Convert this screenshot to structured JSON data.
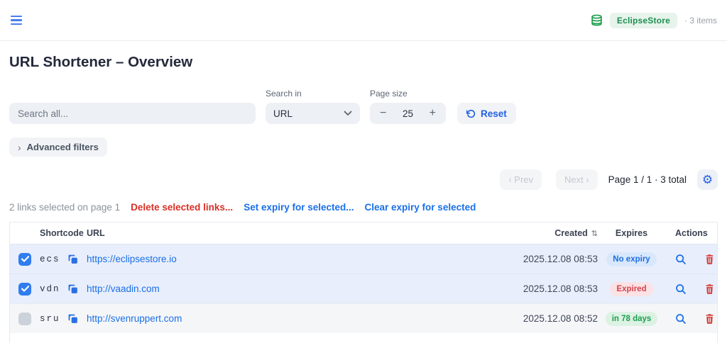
{
  "topbar": {
    "store_badge": "EclipseStore",
    "items_count": "· 3 items"
  },
  "page": {
    "title": "URL Shortener – Overview"
  },
  "filters": {
    "search_placeholder": "Search all...",
    "search_in_label": "Search in",
    "search_in_value": "URL",
    "page_size_label": "Page size",
    "page_size_value": "25",
    "minus_label": "−",
    "plus_label": "+",
    "reset_label": "Reset",
    "advanced_chevron": "›",
    "advanced_label": "Advanced filters"
  },
  "pagination": {
    "prev_label": "‹ Prev",
    "next_label": "Next ›",
    "status": "Page 1 / 1 · 3 total"
  },
  "selection": {
    "info": "2 links selected on page 1",
    "delete_label": "Delete selected links...",
    "set_expiry_label": "Set expiry for selected...",
    "clear_expiry_label": "Clear expiry for selected"
  },
  "table": {
    "headers": {
      "shortcode": "Shortcode",
      "url": "URL",
      "created": "Created",
      "expires": "Expires",
      "actions": "Actions"
    },
    "rows": [
      {
        "shortcode": "ecs",
        "url": "https://eclipsestore.io",
        "created": "2025.12.08 08:53",
        "expiry": "No expiry",
        "selected": true
      },
      {
        "shortcode": "vdn",
        "url": "http://vaadin.com",
        "created": "2025.12.08 08:53",
        "expiry": "Expired",
        "selected": true
      },
      {
        "shortcode": "sru",
        "url": "http://svenruppert.com",
        "created": "2025.12.08 08:52",
        "expiry": "in 78 days",
        "selected": false
      }
    ]
  },
  "icons": {
    "gear": "⚙",
    "sort": "⇅",
    "database": "database-icon",
    "menu": "hamburger-icon",
    "copy": "copy-icon",
    "magnifier": "magnifier-icon",
    "trash": "trash-icon",
    "reset": "rotate-ccw-icon",
    "chevron_down": "chevron-down-icon"
  },
  "colors": {
    "accent_blue": "#1a6fe8",
    "danger_red": "#d93025",
    "success_green": "#1e8e4e",
    "selected_row_bg": "#e8eefb",
    "badge_no_expiry_bg": "#d8e7fc",
    "badge_expired_bg": "#fbe2e4",
    "badge_future_bg": "#dcf2e3",
    "store_badge_bg": "#e6f4ec"
  }
}
